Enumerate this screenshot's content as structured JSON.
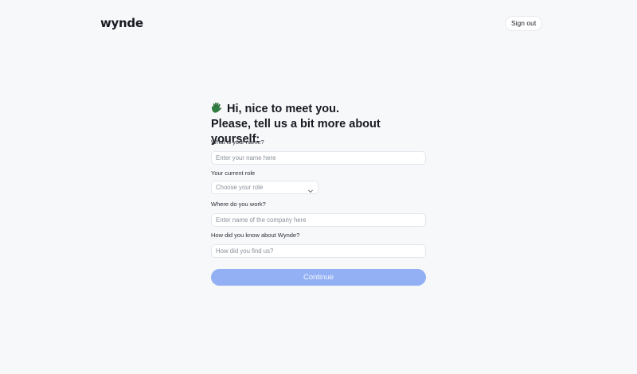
{
  "header": {
    "logo_text": "wynde",
    "sign_out_label": "Sign out"
  },
  "form": {
    "greeting_line": "Hi, nice to meet you.",
    "subheading_line": "Please, tell us a bit more about yourself:",
    "name_label": "What is your name?",
    "name_placeholder": "Enter your name here",
    "role_label": "Your current role",
    "role_placeholder": "Choose your role",
    "company_label": "Where do you work?",
    "company_placeholder": "Enter name of the company here",
    "source_label": "How did you know about Wynde?",
    "source_placeholder": "How did you find us?",
    "continue_label": "Continue"
  },
  "icons": {
    "greeting": "waving-hand-icon",
    "role_dropdown": "chevron-down-icon"
  },
  "colors": {
    "background": "#f7f8fa",
    "continue_button": "#93b0f4",
    "wave_icon": "#2f7d3f"
  }
}
